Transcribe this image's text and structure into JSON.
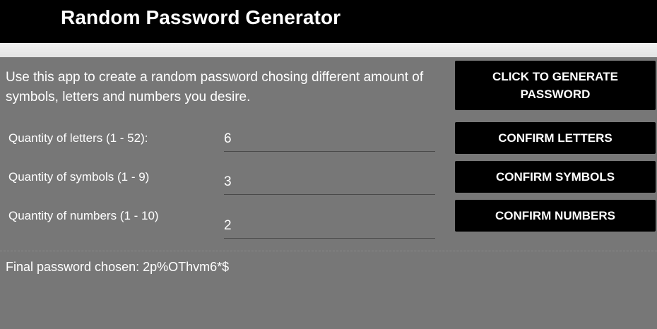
{
  "header": {
    "title": "Random Password Generator"
  },
  "intro": {
    "text": "Use this app to create a random password chosing different amount of symbols, letters and numbers you desire."
  },
  "fields": {
    "letters": {
      "label": "Quantity of letters (1 - 52):",
      "value": "6"
    },
    "symbols": {
      "label": "Quantity of symbols (1 - 9)",
      "value": "3"
    },
    "numbers": {
      "label": "Quantity of numbers (1 - 10)",
      "value": "2"
    }
  },
  "buttons": {
    "generate": "CLICK TO GENERATE PASSWORD",
    "confirm_letters": "CONFIRM LETTERS",
    "confirm_symbols": "CONFIRM SYMBOLS",
    "confirm_numbers": "CONFIRM NUMBERS"
  },
  "result": {
    "text": "Final password chosen: 2p%OThvm6*$"
  },
  "colors": {
    "background": "#777777",
    "header": "#000000",
    "button": "#000000",
    "text": "#ffffff"
  }
}
